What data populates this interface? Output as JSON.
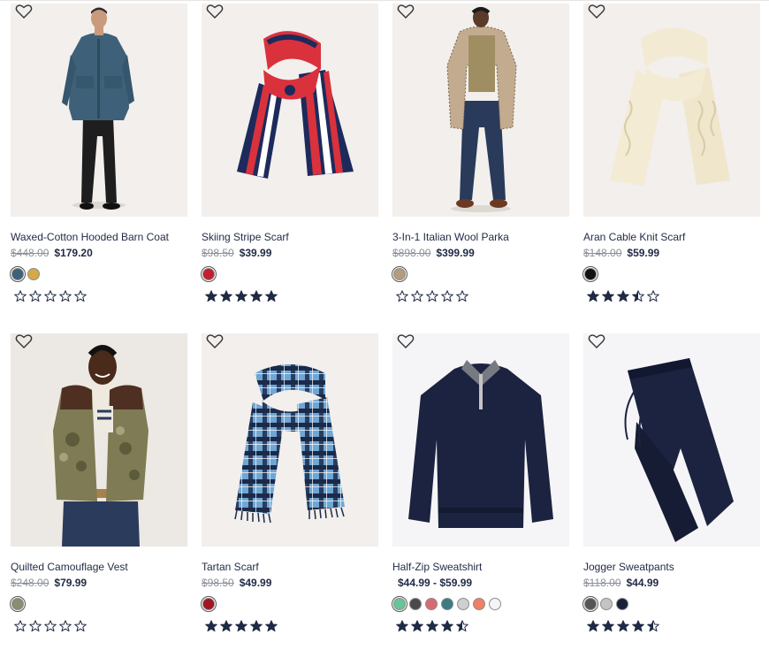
{
  "products": [
    {
      "name": "Waxed-Cotton Hooded Barn Coat",
      "old_price": "$448.00",
      "price": "$179.20",
      "swatches": [
        "#3e6179",
        "#d6a848"
      ],
      "rating": 0,
      "image": "man-in-teal-barn-coat"
    },
    {
      "name": "Skiing Stripe Scarf",
      "old_price": "$98.50",
      "price": "$39.99",
      "swatches": [
        "#c41d2d"
      ],
      "rating": 5,
      "image": "red-navy-striped-scarf"
    },
    {
      "name": "3-In-1 Italian Wool Parka",
      "old_price": "$898.00",
      "price": "$399.99",
      "swatches": [
        "#b49b7e"
      ],
      "rating": 0,
      "image": "man-in-houndstooth-parka"
    },
    {
      "name": "Aran Cable Knit Scarf",
      "old_price": "$148.00",
      "price": "$59.99",
      "swatches": [
        "#111111"
      ],
      "rating": 3.5,
      "image": "cream-cable-knit-scarf"
    },
    {
      "name": "Quilted Camouflage Vest",
      "old_price": "$248.00",
      "price": "$79.99",
      "swatches": [
        "#8a8d6e"
      ],
      "rating": 0,
      "image": "man-in-camouflage-vest"
    },
    {
      "name": "Tartan Scarf",
      "old_price": "$98.50",
      "price": "$49.99",
      "swatches": [
        "#a31523"
      ],
      "rating": 5,
      "image": "blue-tartan-scarf"
    },
    {
      "name": "Half-Zip Sweatshirt",
      "old_price": "",
      "price": "$44.99 - $59.99",
      "swatches": [
        "#66c59a",
        "#4a4a4a",
        "#d86a74",
        "#3c7c80",
        "#cfcfcf",
        "#f07f66",
        "#f3f3f8"
      ],
      "rating": 4.5,
      "image": "navy-half-zip-sweatshirt"
    },
    {
      "name": "Jogger Sweatpants",
      "old_price": "$118.00",
      "price": "$44.99",
      "swatches": [
        "#555555",
        "#c4c4c4",
        "#1b2238"
      ],
      "rating": 4.5,
      "image": "navy-jogger-sweatpants"
    }
  ],
  "colors": {
    "text": "#1f2a44",
    "star": "#1f2a44",
    "strike": "#8a8f99"
  }
}
